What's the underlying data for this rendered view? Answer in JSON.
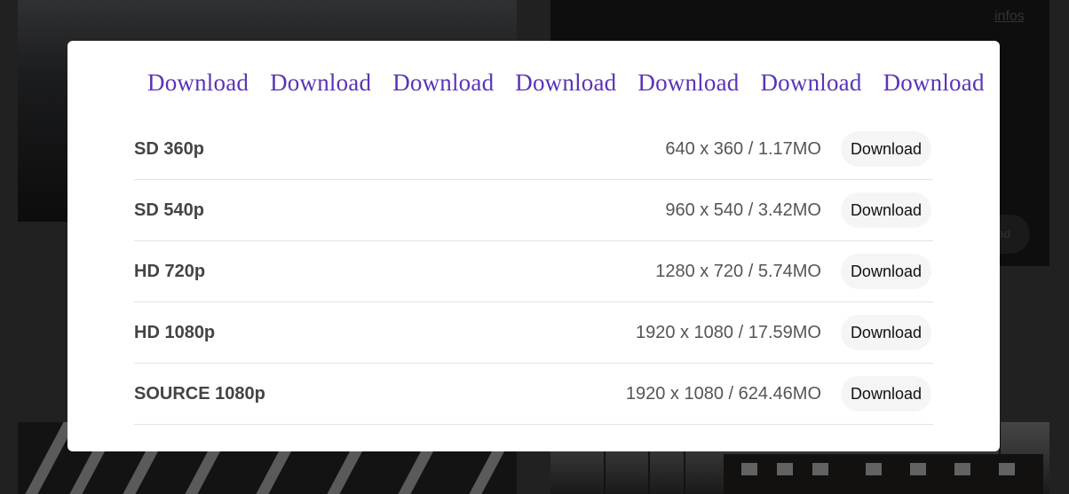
{
  "background": {
    "infos_link": "infos",
    "pill_text": "ad"
  },
  "modal": {
    "download_links": [
      "Download",
      "Download",
      "Download",
      "Download",
      "Download",
      "Download",
      "Download"
    ],
    "rows": [
      {
        "label": "SD 360p",
        "meta": "640 x 360 / 1.17MO",
        "button": "Download"
      },
      {
        "label": "SD 540p",
        "meta": "960 x 540 / 3.42MO",
        "button": "Download"
      },
      {
        "label": "HD 720p",
        "meta": "1280 x 720 / 5.74MO",
        "button": "Download"
      },
      {
        "label": "HD 1080p",
        "meta": "1920 x 1080 / 17.59MO",
        "button": "Download"
      },
      {
        "label": "SOURCE 1080p",
        "meta": "1920 x 1080 / 624.46MO",
        "button": "Download"
      }
    ]
  },
  "colors": {
    "link_purple": "#5a34b8",
    "overlay": "rgba(0,0,0,0.55)",
    "button_bg": "#f5f5f5"
  }
}
